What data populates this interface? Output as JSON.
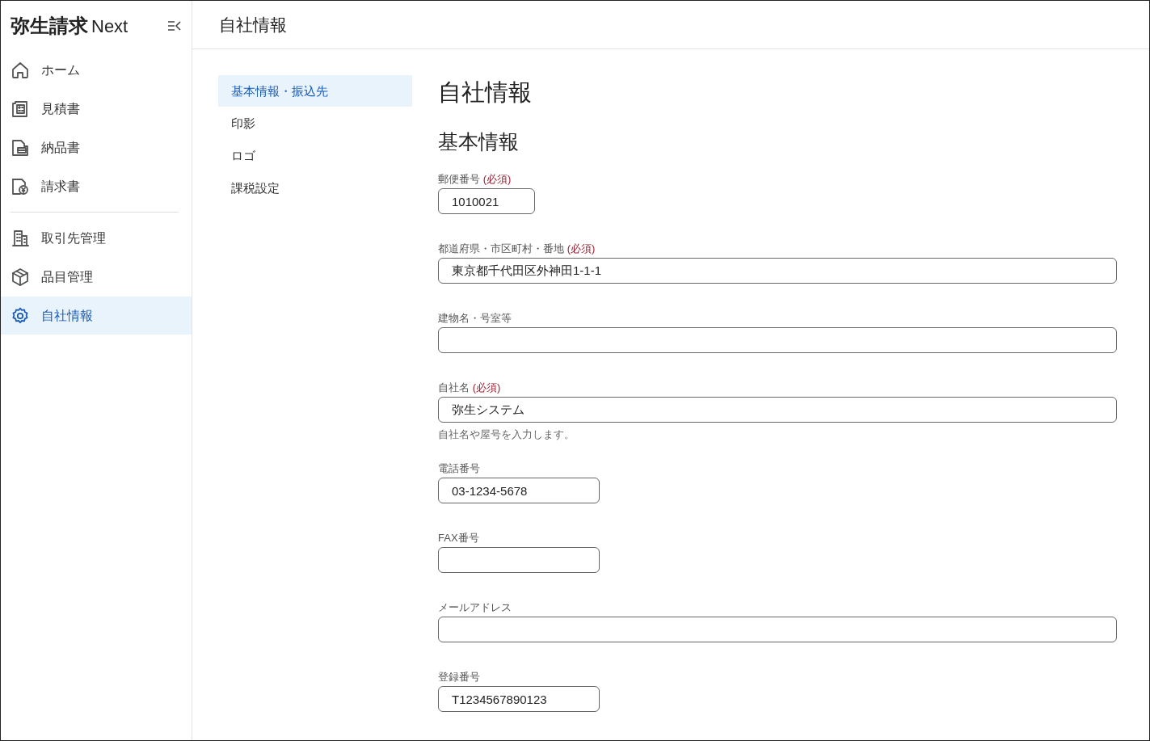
{
  "brand": {
    "title": "弥生請求",
    "suffix": "Next"
  },
  "sidebar": {
    "groups": [
      [
        {
          "label": "ホーム",
          "kind": "home",
          "selected": false
        },
        {
          "label": "見積書",
          "kind": "estimate",
          "selected": false
        },
        {
          "label": "納品書",
          "kind": "delivery",
          "selected": false
        },
        {
          "label": "請求書",
          "kind": "invoice",
          "selected": false
        }
      ],
      [
        {
          "label": "取引先管理",
          "kind": "building",
          "selected": false
        },
        {
          "label": "品目管理",
          "kind": "box",
          "selected": false
        },
        {
          "label": "自社情報",
          "kind": "gear",
          "selected": true
        }
      ]
    ]
  },
  "header": {
    "title": "自社情報"
  },
  "subnav": [
    {
      "label": "基本情報・振込先",
      "selected": true
    },
    {
      "label": "印影",
      "selected": false
    },
    {
      "label": "ロゴ",
      "selected": false
    },
    {
      "label": "課税設定",
      "selected": false
    }
  ],
  "page_title": "自社情報",
  "section_title": "基本情報",
  "fields": [
    {
      "label": "郵便番号",
      "required": "(必須)",
      "value": "1010021",
      "kind": "short"
    },
    {
      "label": "都道府県・市区町村・番地",
      "required": "(必須)",
      "value": "東京都千代田区外神田1-1-1",
      "kind": "full"
    },
    {
      "label": "建物名・号室等",
      "kind": "full"
    },
    {
      "label": "自社名",
      "required": "(必須)",
      "value": "弥生システム",
      "kind": "full",
      "help": "自社名や屋号を入力します。"
    },
    {
      "label": "電話番号",
      "value": "03-1234-5678",
      "kind": "medium"
    },
    {
      "label": "FAX番号",
      "kind": "medium"
    },
    {
      "label": "メールアドレス",
      "kind": "full"
    },
    {
      "label": "登録番号",
      "value": "T1234567890123",
      "kind": "medium"
    }
  ]
}
